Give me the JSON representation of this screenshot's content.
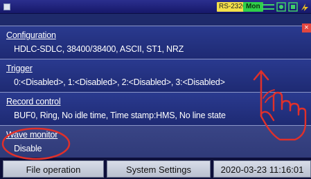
{
  "status_bar": {
    "port_badge": "RS-232C",
    "mode_badge": "Mon",
    "icons": [
      "menu-icon",
      "port-status-icon",
      "record-icon",
      "card-icon",
      "power-icon"
    ]
  },
  "sections": [
    {
      "title": "Configuration",
      "value": "HDLC-SDLC, 38400/38400, ASCII, ST1, NRZ"
    },
    {
      "title": "Trigger",
      "value": "0:<Disabled>, 1:<Disabled>, 2:<Disabled>, 3:<Disabled>"
    },
    {
      "title": "Record control",
      "value": "BUF0, Ring, No idle time, Time stamp:HMS, No line state"
    },
    {
      "title": "Wave monitor",
      "value": "Disable"
    }
  ],
  "close_label": "×",
  "bottom_bar": {
    "file_button": "File operation",
    "settings_button": "System Settings",
    "datetime": "2020-03-23 11:16:01"
  },
  "colors": {
    "panel": "#2a3a8f",
    "annotation_red": "#e0302a",
    "badge_yellow": "#f4e04a",
    "badge_green": "#2fd04a"
  }
}
